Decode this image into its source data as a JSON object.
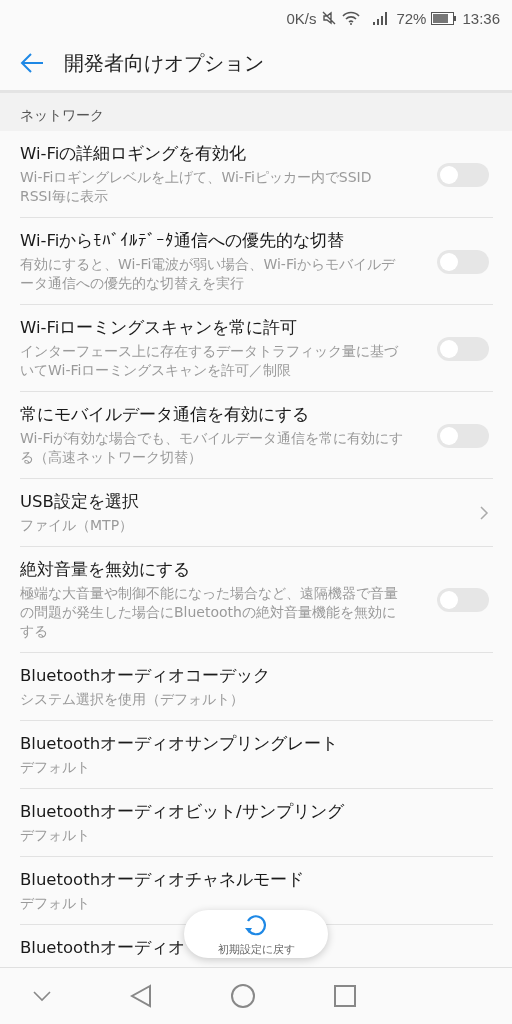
{
  "status_bar": {
    "speed": "0K/s",
    "battery": "72%",
    "time": "13:36"
  },
  "app_bar": {
    "title": "開発者向けオプション"
  },
  "section": {
    "title": "ネットワーク"
  },
  "items": [
    {
      "kind": "switch",
      "title": "Wi-Fiの詳細ロギングを有効化",
      "summary": "Wi-Fiロギングレベルを上げて、Wi-Fiピッカー内でSSID RSSI毎に表示",
      "on": false
    },
    {
      "kind": "switch",
      "title": "Wi-Fiからﾓﾊﾞｲﾙﾃﾞｰﾀ通信への優先的な切替",
      "summary": "有効にすると、Wi-Fi電波が弱い場合、Wi-Fiからモバイルデータ通信への優先的な切替えを実行",
      "on": false
    },
    {
      "kind": "switch",
      "title": "Wi-Fiローミングスキャンを常に許可",
      "summary": "インターフェース上に存在するデータトラフィック量に基づいてWi-Fiローミングスキャンを許可／制限",
      "on": false
    },
    {
      "kind": "switch",
      "title": "常にモバイルデータ通信を有効にする",
      "summary": "Wi-Fiが有効な場合でも、モバイルデータ通信を常に有効にする（高速ネットワーク切替）",
      "on": false
    },
    {
      "kind": "link",
      "title": "USB設定を選択",
      "summary": "ファイル（MTP）"
    },
    {
      "kind": "switch",
      "title": "絶対音量を無効にする",
      "summary": "極端な大音量や制御不能になった場合など、遠隔機器で音量の問題が発生した場合にBluetoothの絶対音量機能を無効にする",
      "on": false
    },
    {
      "kind": "value",
      "title": "Bluetoothオーディオコーデック",
      "summary": "システム選択を使用（デフォルト）"
    },
    {
      "kind": "value",
      "title": "Bluetoothオーディオサンプリングレート",
      "summary": "デフォルト"
    },
    {
      "kind": "value",
      "title": "Bluetoothオーディオビット/サンプリング",
      "summary": "デフォルト"
    },
    {
      "kind": "value",
      "title": "Bluetoothオーディオチャネルモード",
      "summary": "デフォルト"
    },
    {
      "kind": "value",
      "title": "Bluetoothオーディオ"
    }
  ],
  "reset_button": {
    "label": "初期設定に戻す"
  }
}
